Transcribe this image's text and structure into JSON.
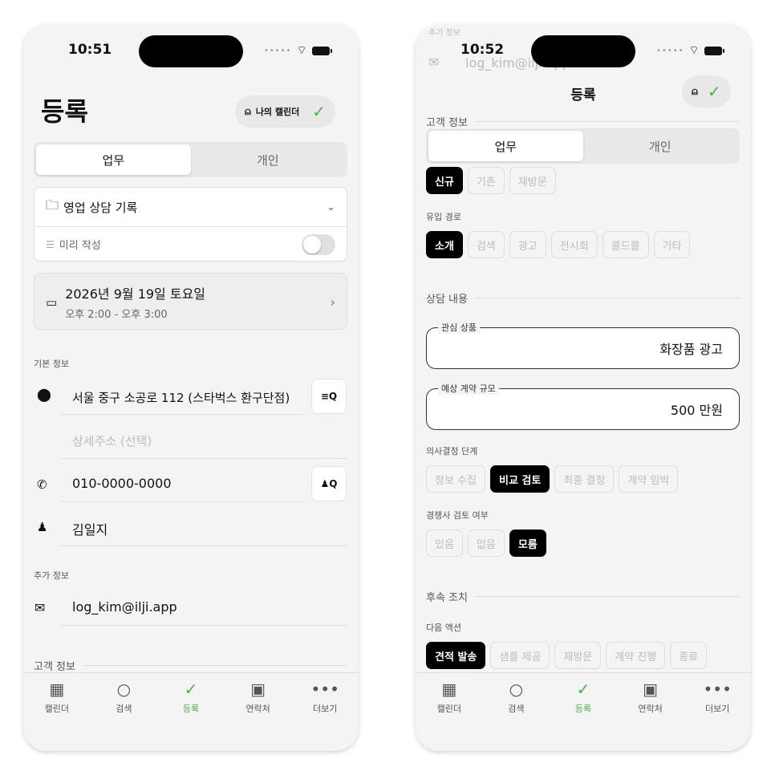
{
  "screen1": {
    "time": "10:51",
    "title": "등록",
    "calendar_pill": "나의 캘린더",
    "segment": [
      "업무",
      "개인"
    ],
    "calendar_select": "영업 상담 기록",
    "draft_label": "미리 작성",
    "date_main": "2026년 9월 19일 토요일",
    "date_sub": "오후 2:00 - 오후 3:00",
    "basic_info": "기본 정보",
    "address": "서울 중구 소공로 112 (스타벅스 환구단점)",
    "address_detail_placeholder": "상세주소 (선택)",
    "phone": "010-0000-0000",
    "name": "김일지",
    "extra_info": "추가 정보",
    "email": "log_kim@ilji.app",
    "customer_info": "고객 정보"
  },
  "screen2": {
    "time": "10:52",
    "ghost_header": "추가 정보",
    "ghost_email": "log_kim@ilji.app",
    "title": "등록",
    "customer_info": "고객 정보",
    "segment": [
      "업무",
      "개인"
    ],
    "customer_type_chips": [
      "신규",
      "기존",
      "재방문"
    ],
    "inflow_label": "유입 경로",
    "inflow_chips": [
      "소개",
      "검색",
      "광고",
      "전시회",
      "콜드콜",
      "기타"
    ],
    "consult_section": "상담 내용",
    "product_label": "관심 상품",
    "product_value": "화장품 광고",
    "scale_label": "예상 계약 규모",
    "scale_value": "500 만원",
    "decision_label": "의사결정 단계",
    "decision_chips": [
      "정보 수집",
      "비교 검토",
      "최종 결정",
      "계약 임박"
    ],
    "competitor_label": "경쟁사 검토 여부",
    "competitor_chips": [
      "있음",
      "없음",
      "모름"
    ],
    "followup_section": "후속 조치",
    "next_label": "다음 액션",
    "next_chips": [
      "견적 발송",
      "샘플 제공",
      "재방문",
      "계약 진행",
      "종료"
    ]
  },
  "tabs": [
    "캘린더",
    "검색",
    "등록",
    "연락처",
    "더보기"
  ],
  "colors": {
    "accent": "#4caf50",
    "selected_chip": "#000000"
  }
}
